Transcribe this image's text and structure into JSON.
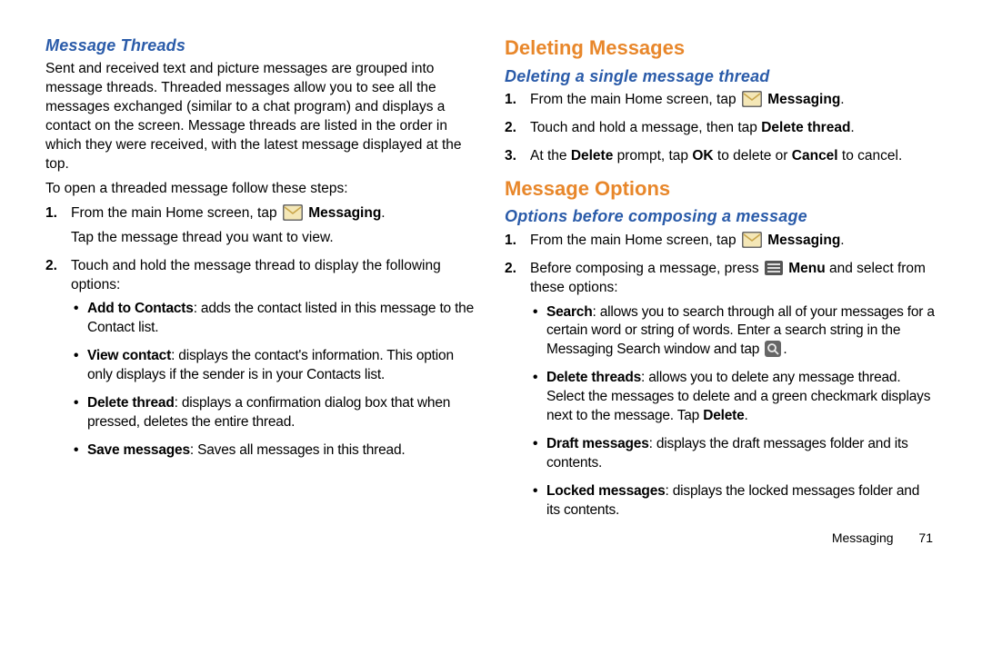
{
  "left": {
    "h_threads": "Message Threads",
    "p_intro": "Sent and received text and picture messages are grouped into message threads. Threaded messages allow you to see all the messages exchanged (similar to a chat program) and displays a contact on the screen. Message threads are listed in the order in which they were received, with the latest message displayed at the top.",
    "p_open": "To open a threaded message follow these steps:",
    "li1_pre": "From the main Home screen, tap ",
    "li1_bold": "Messaging",
    "li1_post": ".",
    "li1_line2": "Tap the message thread you want to view.",
    "li2": "Touch and hold the message thread to display the following options:",
    "b_addc_t": "Add to Contacts",
    "b_addc_d": ": adds the contact listed in this message to the Contact list.",
    "b_viewc_t": "View contact",
    "b_viewc_d": ": displays the contact's information. This option only displays if the sender is in your Contacts list.",
    "b_delth_t": "Delete thread",
    "b_delth_d": ": displays a confirmation dialog box that when pressed, deletes the entire thread.",
    "b_save_t": "Save messages",
    "b_save_d": ": Saves all messages in this thread."
  },
  "right": {
    "h_delmsg": "Deleting Messages",
    "h_delsingle": "Deleting a single message thread",
    "r1_pre": "From the main Home screen, tap ",
    "r1_bold": "Messaging",
    "r1_post": ".",
    "r2_a": "Touch and hold a message, then tap ",
    "r2_b": "Delete thread",
    "r2_c": ".",
    "r3_a": "At the ",
    "r3_b": "Delete",
    "r3_c": " prompt, tap ",
    "r3_d": "OK",
    "r3_e": " to delete or ",
    "r3_f": "Cancel",
    "r3_g": " to cancel.",
    "h_options": "Message Options",
    "h_before": "Options before composing a message",
    "o1_pre": "From the main Home screen, tap ",
    "o1_bold": "Messaging",
    "o1_post": ".",
    "o2_a": "Before composing a message, press ",
    "o2_b": "Menu",
    "o2_c": " and select from these options:",
    "b_search_t": "Search",
    "b_search_d1": ": allows you to search through all of your messages for a certain word or string of words. Enter a search string in the Messaging Search window and tap ",
    "b_search_d2": ".",
    "b_deltr_t": "Delete threads",
    "b_deltr_d1": ": allows you to delete any message thread. Select the messages to delete and a green checkmark displays next to the message. Tap ",
    "b_deltr_d2": "Delete",
    "b_deltr_d3": ".",
    "b_draft_t": "Draft messages",
    "b_draft_d": ": displays the draft messages folder and its contents.",
    "b_locked_t": "Locked messages",
    "b_locked_d": ": displays the locked messages folder and its contents."
  },
  "footer": {
    "section": "Messaging",
    "page": "71"
  }
}
